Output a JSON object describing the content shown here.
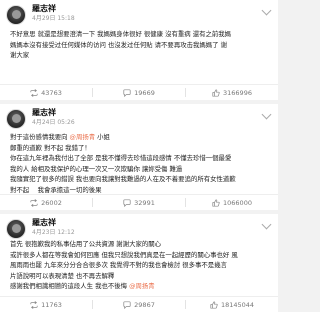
{
  "posts": [
    {
      "author": "羅志祥",
      "time": "4月29日 15:18",
      "source": "",
      "lines": [
        "不好意思 就還是想要澄清一下 我媽媽身体很好 很健康 沒有重病 還有之前我媽",
        "媽媽本沒有接受过任何媒体的访问 也沒发过任何貼 请不要再攻击我媽媽了 谢",
        "谢大家"
      ],
      "counts": {
        "repost": "43763",
        "comment": "19669",
        "like": "3166996"
      }
    },
    {
      "author": "羅志祥",
      "time": "4月24日 05:26",
      "source": "",
      "lines": [
        "對于這份感情我要向 @周扬青 小姐",
        "鄭重的道歉 對不起 我錯了！",
        "你在這九年裡為我付出了全部 是我不懂得去珍惜這段感情 不懂去珍惜一個最愛",
        "我的人 給相及我保护的心理一次又一次欺騙你 讓妳受傷 難過",
        "我隨實犯了很多的錯誤 我也要向我讓對我難過的人在及不着要追的所有女性道歉",
        "對不起 　我會承擔這一切的後果"
      ],
      "counts": {
        "repost": "26002",
        "comment": "32991",
        "like": "1066000"
      }
    },
    {
      "author": "羅志祥",
      "time": "4月23日 12:12",
      "source": "",
      "lines": [
        "首先 很抱歉我的私事佔用了公共資源 謝謝大家的關心",
        "或許很多人都在等我會如何回應 但我只想說我們真是在一起經歷的關心事也好 風",
        "風雨雨也罷 九年來分分合合很多次 我覺得不對的我也會檢討 很多事不是幾言",
        "片語說明可以表現清楚 也不再去解釋",
        "感謝我們相識相戀的這段人生 我也不後悔 @周扬青"
      ],
      "counts": {
        "repost": "11763",
        "comment": "29867",
        "like": "18145044"
      }
    }
  ]
}
